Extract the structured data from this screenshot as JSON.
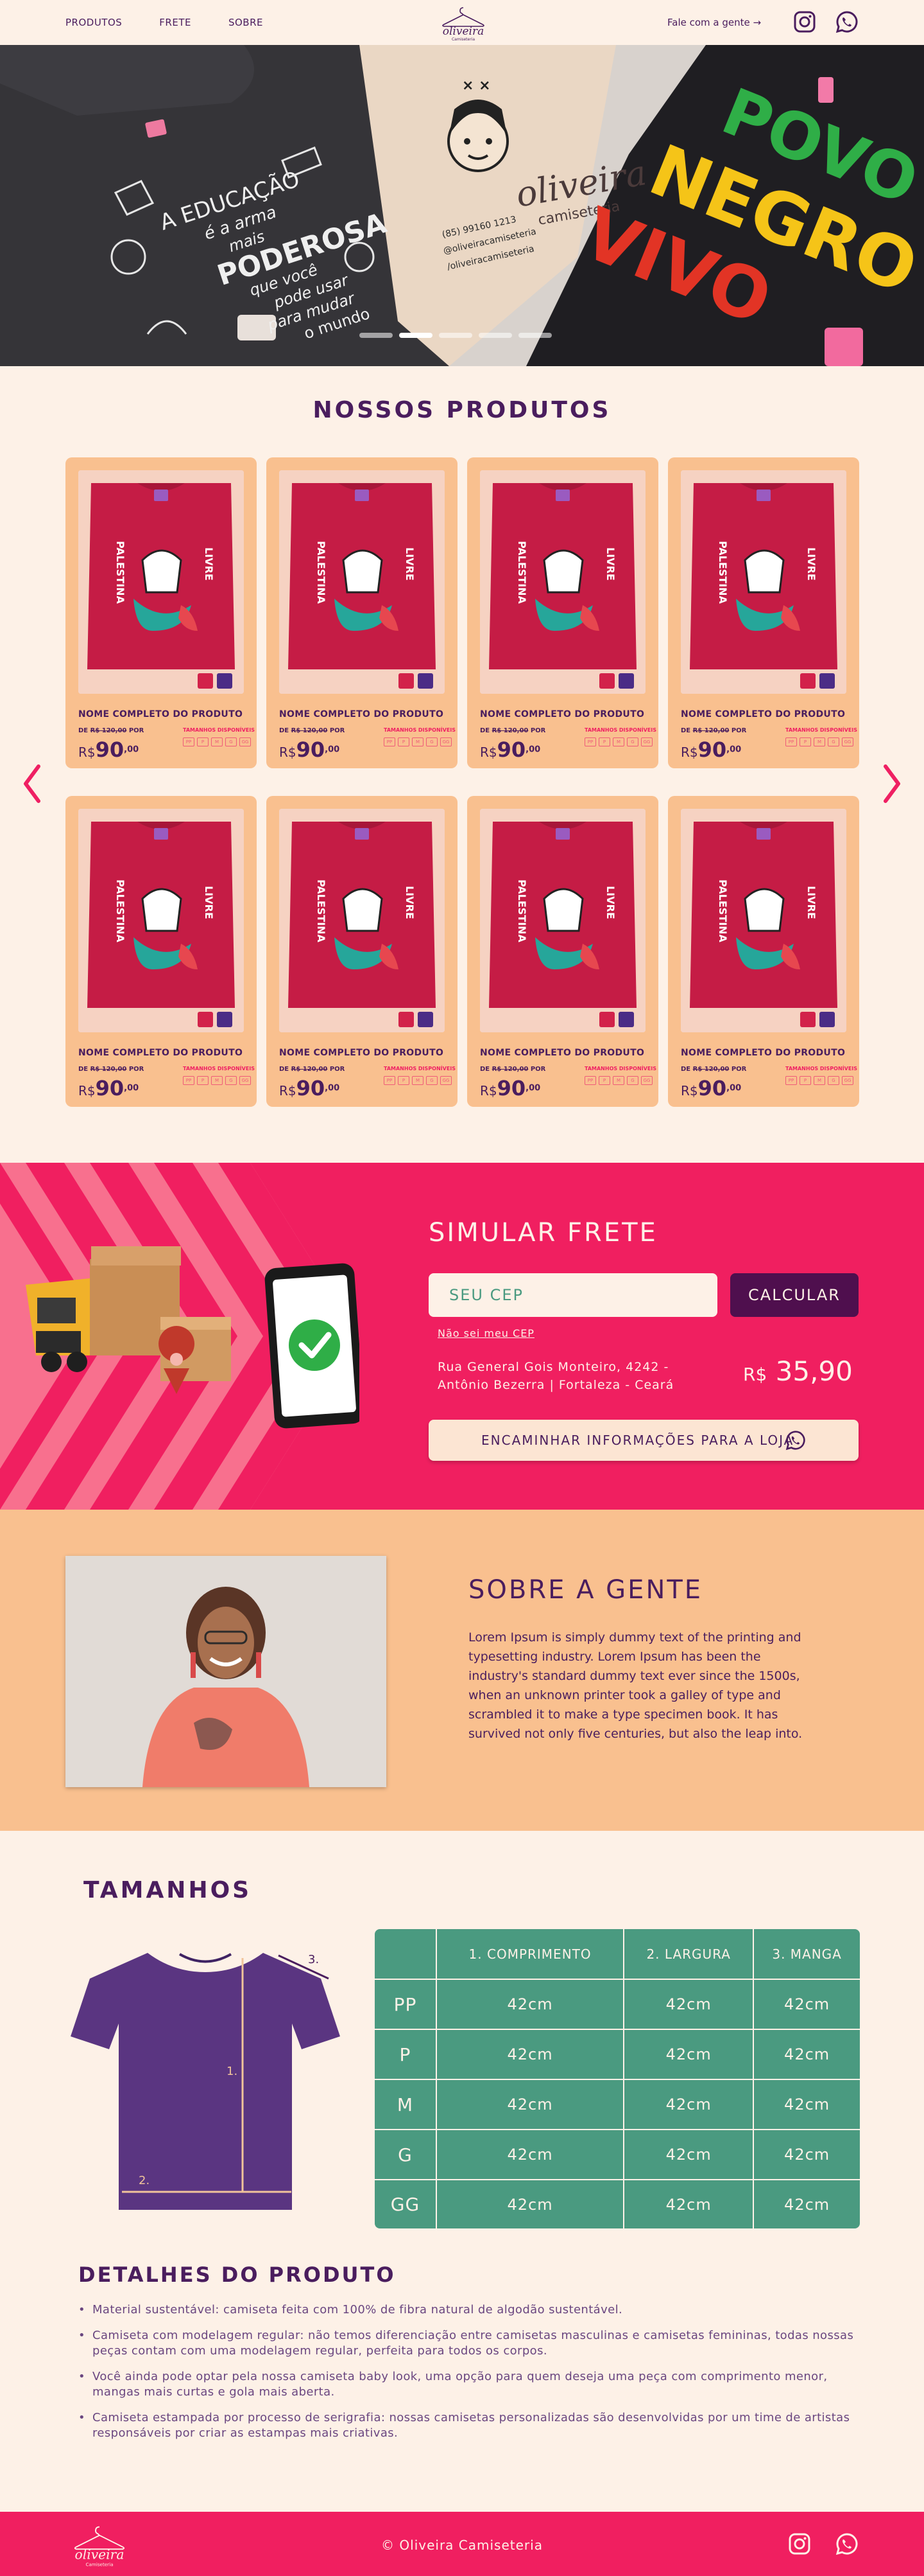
{
  "nav": {
    "links": [
      "PRODUTOS",
      "FRETE",
      "SOBRE"
    ],
    "logo_text": "oliveira",
    "logo_sub": "Camiseteria",
    "contact": "Fale com a gente →"
  },
  "hero": {
    "slides_count": 5,
    "active_slide": 1,
    "shirt_left_text": [
      "A EDUCAÇÃO",
      "é a arma",
      "mais",
      "PODEROSA",
      "que você",
      "pode usar",
      "para mudar",
      "o mundo"
    ],
    "bag_brand": "oliveira",
    "bag_sub": "camiseteria",
    "bag_lines": [
      "(85) 99160 1213",
      "@oliveiracamiseteria",
      "/oliveiracamiseteria"
    ],
    "shirt_right_text": [
      "POVO",
      "NEGRO",
      "VIVO"
    ]
  },
  "products": {
    "title": "NOSSOS PRODUTOS",
    "shirt_print_left": "PALESTINA",
    "shirt_print_right": "LIVRE",
    "items": [
      {
        "name": "NOME COMPLETO DO PRODUTO",
        "old_label": "DE",
        "old_price": "R$ 120,00",
        "por": "POR",
        "sizes_label": "TAMANHOS DISPONÍVEIS",
        "currency": "R$",
        "price": "90",
        "cents": ",00",
        "sizes": [
          "PP",
          "P",
          "M",
          "G",
          "GG"
        ],
        "colors": [
          "#d2224a",
          "#4b2c86"
        ]
      },
      {
        "name": "NOME COMPLETO DO PRODUTO",
        "old_label": "DE",
        "old_price": "R$ 120,00",
        "por": "POR",
        "sizes_label": "TAMANHOS DISPONÍVEIS",
        "currency": "R$",
        "price": "90",
        "cents": ",00",
        "sizes": [
          "PP",
          "P",
          "M",
          "G",
          "GG"
        ],
        "colors": [
          "#d2224a",
          "#4b2c86"
        ]
      },
      {
        "name": "NOME COMPLETO DO PRODUTO",
        "old_label": "DE",
        "old_price": "R$ 120,00",
        "por": "POR",
        "sizes_label": "TAMANHOS DISPONÍVEIS",
        "currency": "R$",
        "price": "90",
        "cents": ",00",
        "sizes": [
          "PP",
          "P",
          "M",
          "G",
          "GG"
        ],
        "colors": [
          "#d2224a",
          "#4b2c86"
        ]
      },
      {
        "name": "NOME COMPLETO DO PRODUTO",
        "old_label": "DE",
        "old_price": "R$ 120,00",
        "por": "POR",
        "sizes_label": "TAMANHOS DISPONÍVEIS",
        "currency": "R$",
        "price": "90",
        "cents": ",00",
        "sizes": [
          "PP",
          "P",
          "M",
          "G",
          "GG"
        ],
        "colors": [
          "#d2224a",
          "#4b2c86"
        ]
      },
      {
        "name": "NOME COMPLETO DO PRODUTO",
        "old_label": "DE",
        "old_price": "R$ 120,00",
        "por": "POR",
        "sizes_label": "TAMANHOS DISPONÍVEIS",
        "currency": "R$",
        "price": "90",
        "cents": ",00",
        "sizes": [
          "PP",
          "P",
          "M",
          "G",
          "GG"
        ],
        "colors": [
          "#d2224a",
          "#4b2c86"
        ]
      },
      {
        "name": "NOME COMPLETO DO PRODUTO",
        "old_label": "DE",
        "old_price": "R$ 120,00",
        "por": "POR",
        "sizes_label": "TAMANHOS DISPONÍVEIS",
        "currency": "R$",
        "price": "90",
        "cents": ",00",
        "sizes": [
          "PP",
          "P",
          "M",
          "G",
          "GG"
        ],
        "colors": [
          "#d2224a",
          "#4b2c86"
        ]
      },
      {
        "name": "NOME COMPLETO DO PRODUTO",
        "old_label": "DE",
        "old_price": "R$ 120,00",
        "por": "POR",
        "sizes_label": "TAMANHOS DISPONÍVEIS",
        "currency": "R$",
        "price": "90",
        "cents": ",00",
        "sizes": [
          "PP",
          "P",
          "M",
          "G",
          "GG"
        ],
        "colors": [
          "#d2224a",
          "#4b2c86"
        ]
      },
      {
        "name": "NOME COMPLETO DO PRODUTO",
        "old_label": "DE",
        "old_price": "R$ 120,00",
        "por": "POR",
        "sizes_label": "TAMANHOS DISPONÍVEIS",
        "currency": "R$",
        "price": "90",
        "cents": ",00",
        "sizes": [
          "PP",
          "P",
          "M",
          "G",
          "GG"
        ],
        "colors": [
          "#d2224a",
          "#4b2c86"
        ]
      }
    ]
  },
  "frete": {
    "title": "SIMULAR FRETE",
    "cep_placeholder": "SEU CEP",
    "calc_label": "CALCULAR",
    "no_cep": "Não sei meu CEP",
    "address_line1": "Rua General Gois Monteiro, 4242 -",
    "address_line2": "Antônio Bezerra | Fortaleza - Ceará",
    "price_currency": "R$",
    "price_value": "35,90",
    "send_label": "ENCAMINHAR INFORMAÇÕES PARA A LOJA"
  },
  "sobre": {
    "title": "SOBRE A GENTE",
    "text": "Lorem Ipsum is simply dummy text of the printing and typesetting industry. Lorem Ipsum has been the industry's standard dummy text ever since the 1500s, when an unknown printer took a galley of type and scrambled it to make a type specimen book. It has survived not only five centuries, but also the leap into."
  },
  "tamanhos": {
    "title": "TAMANHOS",
    "marker_1": "1.",
    "marker_2": "2.",
    "marker_3": "3.",
    "columns": [
      "",
      "1. COMPRIMENTO",
      "2. LARGURA",
      "3. MANGA"
    ],
    "rows": [
      [
        "PP",
        "42cm",
        "42cm",
        "42cm"
      ],
      [
        "P",
        "42cm",
        "42cm",
        "42cm"
      ],
      [
        "M",
        "42cm",
        "42cm",
        "42cm"
      ],
      [
        "G",
        "42cm",
        "42cm",
        "42cm"
      ],
      [
        "GG",
        "42cm",
        "42cm",
        "42cm"
      ]
    ]
  },
  "detalhes": {
    "title": "DETALHES DO PRODUTO",
    "items": [
      "Material sustentável: camiseta feita com 100% de fibra natural de algodão sustentável.",
      "Camiseta com modelagem regular: não temos diferenciação entre camisetas masculinas e camisetas femininas, todas nossas peças contam com uma modelagem regular, perfeita para todos os corpos.",
      "Você ainda pode optar pela nossa camiseta baby look, uma opção para quem deseja uma peça com comprimento menor, mangas mais curtas e gola mais aberta.",
      "Camiseta estampada por processo de serigrafia: nossas camisetas personalizadas são desenvolvidas por um time de artistas responsáveis por criar as estampas mais criativas."
    ]
  },
  "footer": {
    "copyright": "© Oliveira Camiseteria"
  },
  "colors": {
    "cream": "#fdf1e7",
    "purple": "#4a1d5e",
    "pink": "#f01f60",
    "peach": "#f9c08f",
    "teal": "#4a9a80"
  }
}
